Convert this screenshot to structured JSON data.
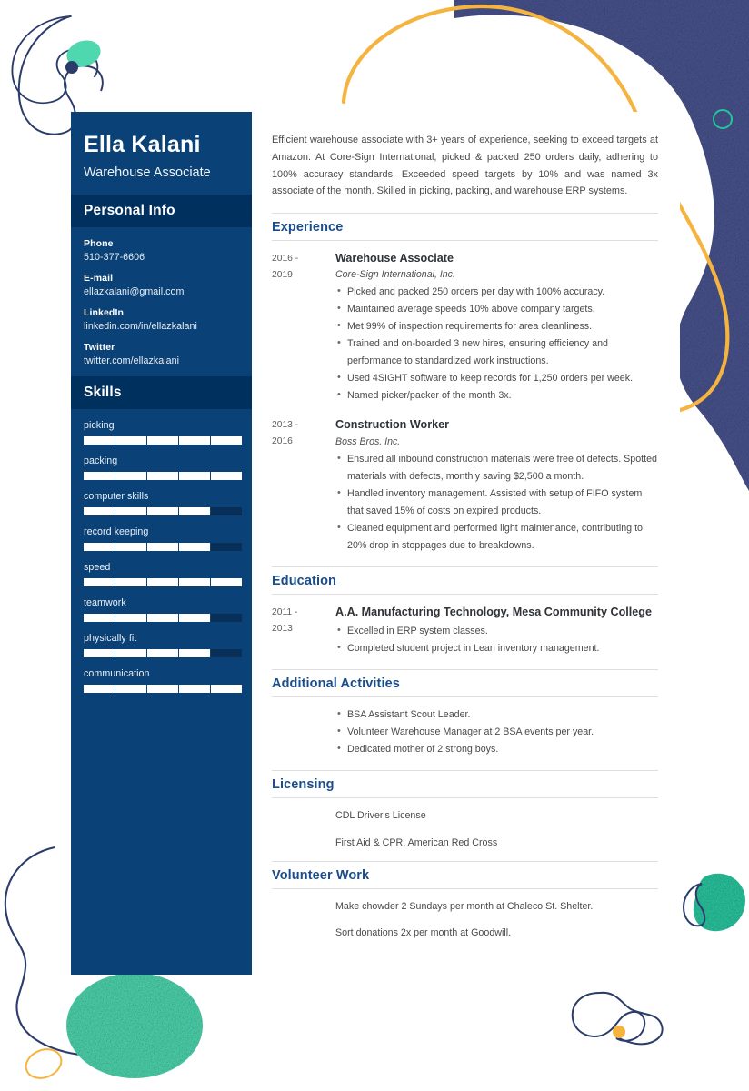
{
  "colors": {
    "sidebar": "#0a4176",
    "sidebar_band": "#00305e",
    "accent_heading": "#1a4d8c",
    "decor_navy": "#2b3c6b",
    "decor_navy_fill": "#4a558f",
    "decor_teal": "#3fd6ad",
    "decor_teal_dark": "#27c39b",
    "decor_orange": "#f5b33f",
    "body_text": "#4a4a4a"
  },
  "sidebar": {
    "name": "Ella Kalani",
    "job_title": "Warehouse Associate",
    "personal_info_heading": "Personal Info",
    "contacts": [
      {
        "label": "Phone",
        "value": "510-377-6606"
      },
      {
        "label": "E-mail",
        "value": "ellazkalani@gmail.com"
      },
      {
        "label": "LinkedIn",
        "value": "linkedin.com/in/ellazkalani"
      },
      {
        "label": "Twitter",
        "value": "twitter.com/ellazkalani"
      }
    ],
    "skills_heading": "Skills",
    "skills": [
      {
        "name": "picking",
        "level": 5,
        "max": 5
      },
      {
        "name": "packing",
        "level": 5,
        "max": 5
      },
      {
        "name": "computer skills",
        "level": 4,
        "max": 5
      },
      {
        "name": "record keeping",
        "level": 4,
        "max": 5
      },
      {
        "name": "speed",
        "level": 5,
        "max": 5
      },
      {
        "name": "teamwork",
        "level": 4,
        "max": 5
      },
      {
        "name": "physically fit",
        "level": 4,
        "max": 5
      },
      {
        "name": "communication",
        "level": 5,
        "max": 5
      }
    ]
  },
  "main": {
    "summary": "Efficient warehouse associate with 3+ years of experience, seeking to exceed targets at Amazon. At Core-Sign International, picked & packed 250 orders daily, adhering to 100% accuracy standards. Exceeded speed targets by 10% and was named 3x associate of the month. Skilled in picking, packing, and warehouse ERP systems.",
    "sections": [
      {
        "id": "experience",
        "title": "Experience",
        "entries": [
          {
            "dates": "2016 - 2019",
            "role": "Warehouse Associate",
            "org": "Core-Sign International, Inc.",
            "bullets": [
              "Picked and packed 250 orders per day with 100% accuracy.",
              "Maintained average speeds 10% above company targets.",
              "Met 99% of inspection requirements for area cleanliness.",
              "Trained and on-boarded 3 new hires, ensuring efficiency and performance to standardized work instructions.",
              "Used 4SIGHT software to keep records for 1,250 orders per week.",
              "Named picker/packer of the month 3x."
            ]
          },
          {
            "dates": "2013 - 2016",
            "role": "Construction Worker",
            "org": "Boss Bros. Inc.",
            "bullets": [
              "Ensured all inbound construction materials were free of defects. Spotted materials with defects, monthly saving $2,500 a month.",
              "Handled inventory management. Assisted with setup of FIFO system that saved 15% of costs on expired products.",
              "Cleaned equipment and performed light maintenance, contributing to 20% drop in stoppages due to breakdowns."
            ]
          }
        ]
      },
      {
        "id": "education",
        "title": "Education",
        "entries": [
          {
            "dates": "2011 - 2013",
            "role": "A.A. Manufacturing Technology, Mesa Community College",
            "org": "",
            "bullets": [
              "Excelled in ERP system classes.",
              "Completed student project in Lean inventory management."
            ]
          }
        ]
      },
      {
        "id": "additional-activities",
        "title": "Additional Activities",
        "entries": [
          {
            "dates": "",
            "role": "",
            "org": "",
            "bullets": [
              "BSA Assistant Scout Leader.",
              "Volunteer Warehouse Manager at 2 BSA events per year.",
              "Dedicated mother of 2 strong boys."
            ]
          }
        ]
      },
      {
        "id": "licensing",
        "title": "Licensing",
        "lines": [
          "CDL Driver's License",
          "First Aid & CPR, American Red Cross"
        ]
      },
      {
        "id": "volunteer-work",
        "title": "Volunteer Work",
        "lines": [
          "Make chowder 2 Sundays per month at Chaleco St. Shelter.",
          "Sort donations 2x per month at Goodwill."
        ]
      }
    ]
  }
}
